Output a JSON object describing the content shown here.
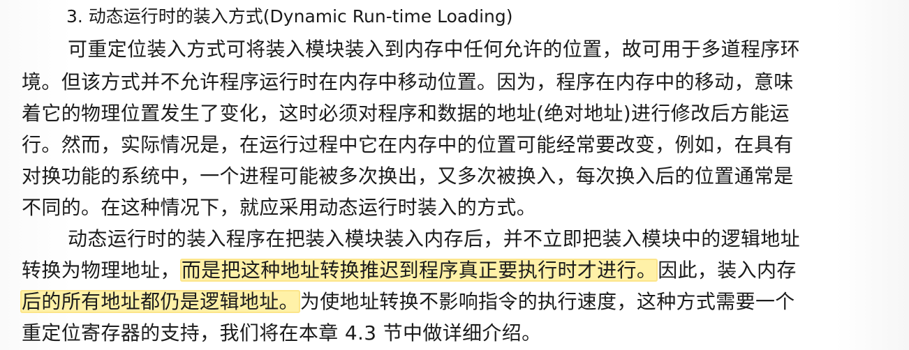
{
  "document": {
    "heading": "3. 动态运行时的装入方式(Dynamic Run-time Loading)",
    "lines": [
      "可重定位装入方式可将装入模块装入到内存中任何允许的位置，故可用于多道程序环",
      "境。但该方式并不允许程序运行时在内存中移动位置。因为，程序在内存中的移动，意味",
      "着它的物理位置发生了变化，这时必须对程序和数据的地址(绝对地址)进行修改后方能运",
      "行。然而，实际情况是，在运行过程中它在内存中的位置可能经常要改变，例如，在具有",
      "对换功能的系统中，一个进程可能被多次换出，又多次被换入，每次换入后的位置通常是",
      "不同的。在这种情况下，就应采用动态运行时装入的方式。",
      "动态运行时的装入程序在把装入模块装入内存后，并不立即把装入模块中的逻辑地址"
    ],
    "line8": {
      "before": "转换为物理地址，",
      "highlight": "而是把这种地址转换推迟到程序真正要执行时才进行。",
      "after": "因此，装入内存"
    },
    "line9": {
      "highlight": "后的所有地址都仍是逻辑地址。",
      "after": "为使地址转换不影响指令的执行速度，这种方式需要一个"
    },
    "line10": "重定位寄存器的支持，我们将在本章 4.3 节中做详细介绍。"
  },
  "colors": {
    "text": "#1c1c1c",
    "highlight": "#fff1a8"
  }
}
